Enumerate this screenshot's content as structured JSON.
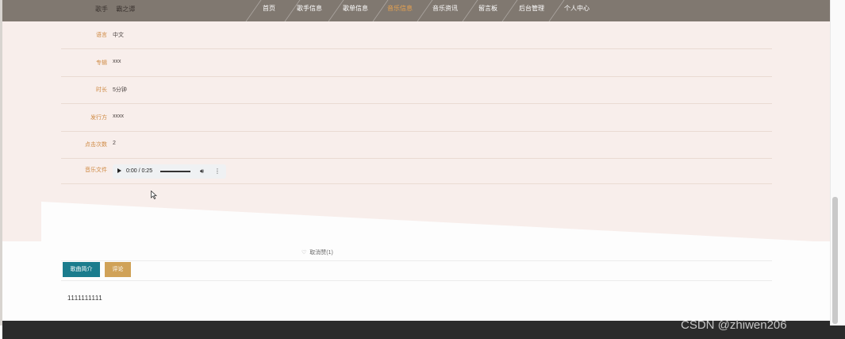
{
  "header": {
    "singer_label": "歌手",
    "singer_value": "霸之谭",
    "nav": [
      {
        "label": "首页",
        "active": false
      },
      {
        "label": "歌手信息",
        "active": false
      },
      {
        "label": "歌单信息",
        "active": false
      },
      {
        "label": "音乐信息",
        "active": true
      },
      {
        "label": "音乐资讯",
        "active": false
      },
      {
        "label": "留言板",
        "active": false
      },
      {
        "label": "后台管理",
        "active": false
      },
      {
        "label": "个人中心",
        "active": false
      }
    ]
  },
  "details": [
    {
      "label": "语言",
      "value": "中文"
    },
    {
      "label": "专辑",
      "value": "xxx"
    },
    {
      "label": "时长",
      "value": "5分钟"
    },
    {
      "label": "发行方",
      "value": "xxxx"
    },
    {
      "label": "点击次数",
      "value": "2"
    },
    {
      "label": "音乐文件",
      "value": ""
    }
  ],
  "player": {
    "time": "0:00 / 0:25",
    "volume_level": 1.0,
    "progress": 0.0,
    "play_icon": "play-icon",
    "volume_icon": "volume-icon",
    "more_icon": "more-options-icon"
  },
  "like": {
    "icon": "heart-icon",
    "label": "取消赞(1)"
  },
  "tabs": [
    {
      "label": "歌曲简介",
      "active": true,
      "color": "#1b7c8d"
    },
    {
      "label": "评论",
      "active": false,
      "color": "#d0a258"
    }
  ],
  "content": {
    "text": "1111111111"
  },
  "watermark": "CSDN @zhiwen206"
}
